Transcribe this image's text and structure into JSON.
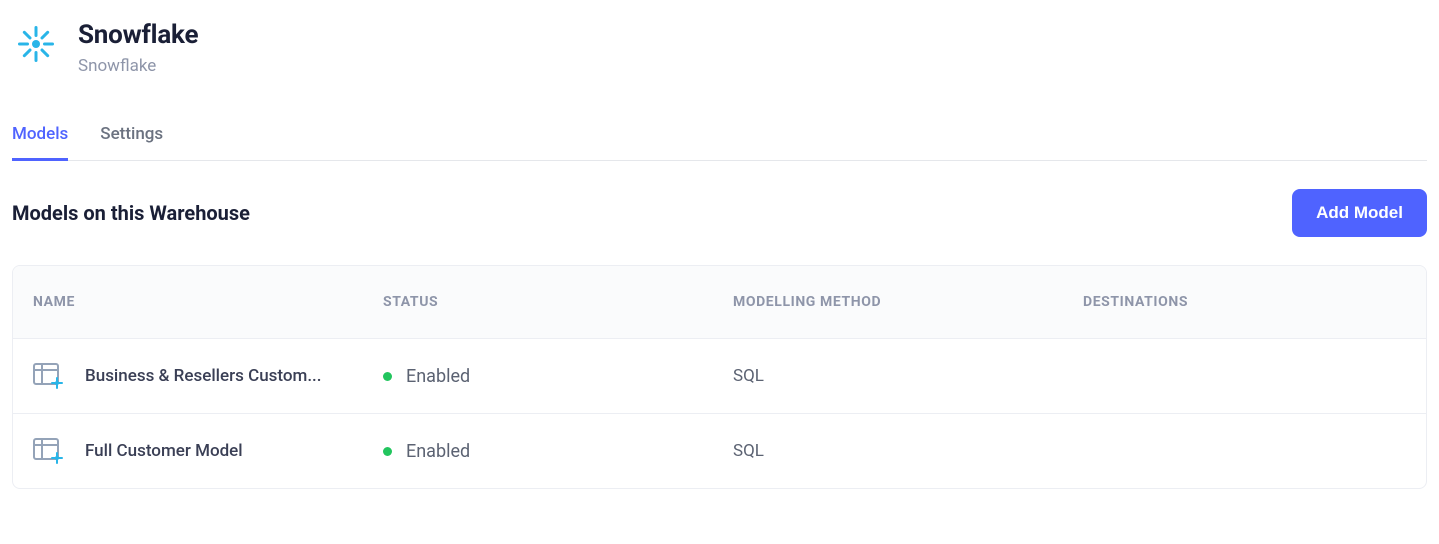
{
  "header": {
    "title": "Snowflake",
    "subtitle": "Snowflake"
  },
  "tabs": [
    {
      "label": "Models",
      "active": true
    },
    {
      "label": "Settings",
      "active": false
    }
  ],
  "section": {
    "title": "Models on this Warehouse",
    "add_button_label": "Add Model"
  },
  "table": {
    "columns": [
      "NAME",
      "STATUS",
      "MODELLING METHOD",
      "DESTINATIONS"
    ],
    "rows": [
      {
        "name": "Business & Resellers Custom...",
        "status": "Enabled",
        "status_color": "#22c55e",
        "method": "SQL",
        "destinations": ""
      },
      {
        "name": "Full Customer Model",
        "status": "Enabled",
        "status_color": "#22c55e",
        "method": "SQL",
        "destinations": ""
      }
    ]
  }
}
